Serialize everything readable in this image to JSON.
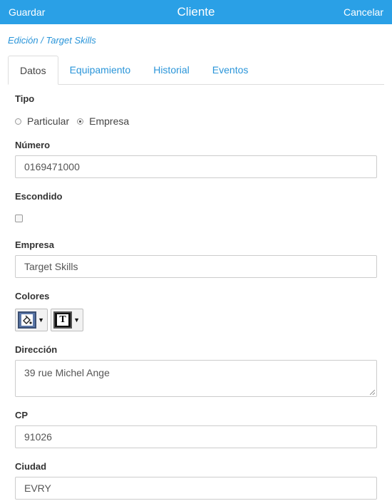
{
  "header": {
    "save_label": "Guardar",
    "title": "Cliente",
    "cancel_label": "Cancelar"
  },
  "breadcrumb": "Edición / Target Skills",
  "tabs": [
    {
      "label": "Datos",
      "active": true
    },
    {
      "label": "Equipamiento",
      "active": false
    },
    {
      "label": "Historial",
      "active": false
    },
    {
      "label": "Eventos",
      "active": false
    }
  ],
  "form": {
    "tipo": {
      "label": "Tipo",
      "options": [
        "Particular",
        "Empresa"
      ],
      "selected": "Empresa"
    },
    "numero": {
      "label": "Número",
      "value": "0169471000"
    },
    "escondido": {
      "label": "Escondido",
      "checked": false
    },
    "empresa": {
      "label": "Empresa",
      "value": "Target Skills"
    },
    "colores": {
      "label": "Colores",
      "background_color": "#5b77a8",
      "text_color": "#111111",
      "background_icon": "paint-bucket-icon",
      "text_icon": "text-color-icon"
    },
    "direccion": {
      "label": "Dirección",
      "value": "39 rue Michel Ange"
    },
    "cp": {
      "label": "CP",
      "value": "91026"
    },
    "ciudad": {
      "label": "Ciudad",
      "value": "EVRY"
    }
  },
  "colors": {
    "accent": "#2aa0e6",
    "link": "#2a95d9"
  }
}
